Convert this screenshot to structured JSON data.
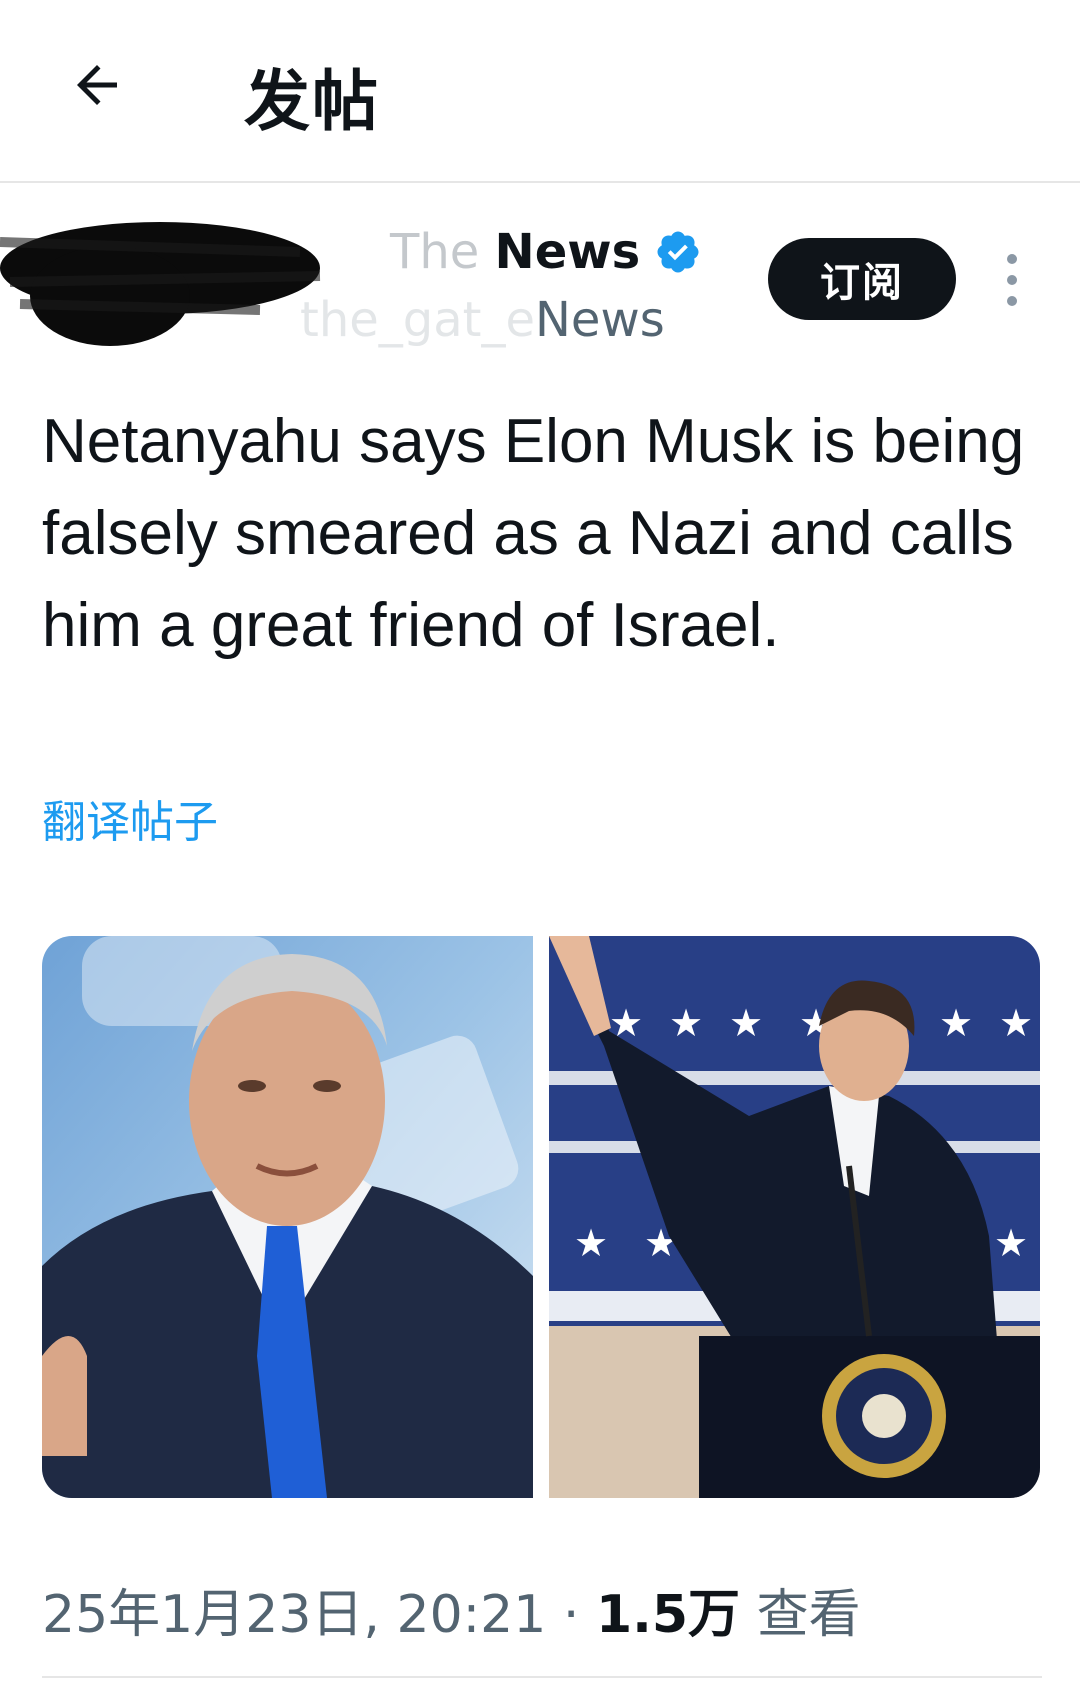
{
  "header": {
    "title": "发帖",
    "back_icon": "arrow-left-icon"
  },
  "author": {
    "name_visible": "News",
    "name_faded": "The ",
    "handle_visible": "News",
    "handle_faded": "the_gat_e",
    "verified_icon": "verified-badge-icon"
  },
  "subscribe_label": "订阅",
  "post": {
    "text": "Netanyahu says Elon Musk is being falsely smeared as a Nazi and calls him a great friend of Israel.",
    "translate_label": "翻译帖子"
  },
  "media": [
    {
      "name": "netanyahu-photo"
    },
    {
      "name": "musk-photo"
    }
  ],
  "meta": {
    "date": "25年1月23日, 20:21",
    "separator": "·",
    "views_count": "1.5万",
    "views_label": "查看"
  },
  "colors": {
    "accent": "#1d9bf0",
    "text": "#0f1419",
    "secondary": "#536471"
  }
}
